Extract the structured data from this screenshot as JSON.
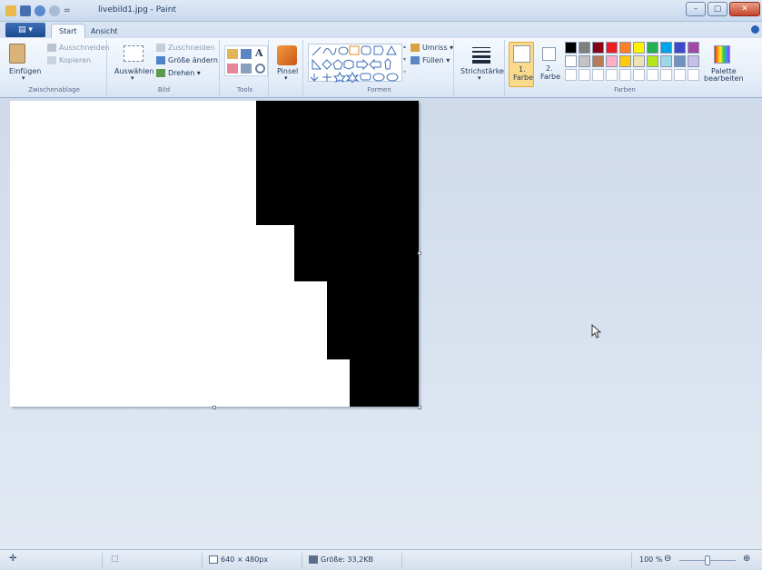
{
  "window": {
    "title": "livebild1.jpg - Paint",
    "qa_separator": "=",
    "controls": {
      "minimize": "–",
      "maximize": "▢",
      "close": "✕"
    }
  },
  "tabs": {
    "menu_glyph": "▤ ▾",
    "start": "Start",
    "view": "Ansicht"
  },
  "ribbon": {
    "clipboard": {
      "paste": "Einfügen",
      "cut": "Ausschneiden",
      "copy": "Kopieren",
      "label": "Zwischenablage"
    },
    "image": {
      "select": "Auswählen",
      "crop": "Zuschneiden",
      "resize": "Größe ändern",
      "rotate": "Drehen ▾",
      "label": "Bild"
    },
    "tools": {
      "text_tool": "A",
      "label": "Tools"
    },
    "brushes": {
      "label": "Pinsel"
    },
    "shapes": {
      "outline": "Umriss ▾",
      "fill": "Füllen ▾",
      "label": "Formen"
    },
    "stroke": {
      "label": "Strichstärke"
    },
    "colors": {
      "color1_line1": "1.",
      "color1_line2": "Farbe",
      "color2_line1": "2.",
      "color2_line2": "Farbe",
      "edit_line1": "Palette",
      "edit_line2": "bearbeiten",
      "label": "Farben",
      "row1": [
        "#000000",
        "#7f7f7f",
        "#880015",
        "#ed1c24",
        "#ff7f27",
        "#fff200",
        "#22b14c",
        "#00a2e8",
        "#3f48cc",
        "#a349a4"
      ],
      "row2": [
        "#ffffff",
        "#c3c3c3",
        "#b97a57",
        "#ffaec9",
        "#ffc90e",
        "#efe4b0",
        "#b5e61d",
        "#99d9ea",
        "#7092be",
        "#c8bfe7"
      ]
    }
  },
  "status": {
    "move_icon": "✛",
    "select_icon": "⬚",
    "dimensions": "640 × 480px",
    "size": "Größe: 33,2KB",
    "zoom": "100 %",
    "zoom_out": "⊖",
    "zoom_in": "⊕"
  }
}
